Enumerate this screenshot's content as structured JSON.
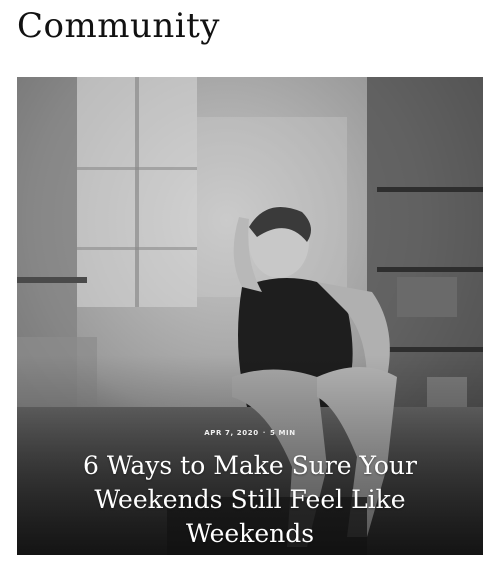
{
  "section": {
    "title": "Community"
  },
  "featured_article": {
    "date": "APR 7, 2020",
    "read_time": "5 MIN",
    "headline": "6 Ways to Make Sure Your Weekends Still Feel Like Weekends",
    "image": {
      "style": "black-and-white photograph",
      "subject": "woman seated in a dim workshop"
    }
  }
}
